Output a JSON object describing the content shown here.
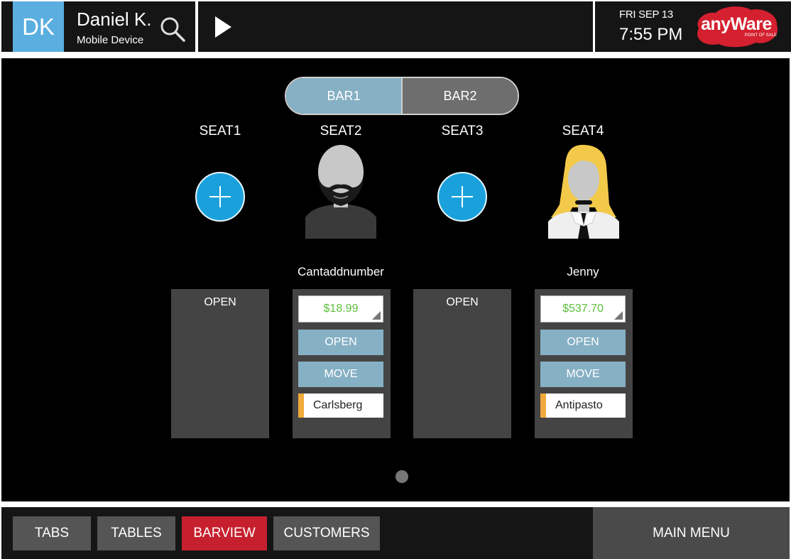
{
  "header": {
    "initials": "DK",
    "user_name": "Daniel K.",
    "device": "Mobile Device",
    "date": "FRI SEP 13",
    "time": "7:55 PM",
    "logo_text": "anyWare",
    "logo_subtext": "POINT OF SALE",
    "search_icon": "search-icon",
    "play_icon": "play-icon"
  },
  "bars": [
    {
      "label": "BAR1",
      "active": true
    },
    {
      "label": "BAR2",
      "active": false
    }
  ],
  "seats": [
    {
      "label": "SEAT1",
      "occupied": false,
      "open_label": "OPEN"
    },
    {
      "label": "SEAT2",
      "occupied": true,
      "customer": "Cantaddnumber",
      "amount": "$18.99",
      "open_label": "OPEN",
      "move_label": "MOVE",
      "item": "Carlsberg"
    },
    {
      "label": "SEAT3",
      "occupied": false,
      "open_label": "OPEN"
    },
    {
      "label": "SEAT4",
      "occupied": true,
      "customer": "Jenny",
      "amount": "$537.70",
      "open_label": "OPEN",
      "move_label": "MOVE",
      "item": "Antipasto"
    }
  ],
  "footer": {
    "tabs": [
      {
        "label": "TABS",
        "active": false
      },
      {
        "label": "TABLES",
        "active": false
      },
      {
        "label": "BARVIEW",
        "active": true
      },
      {
        "label": "CUSTOMERS",
        "active": false
      }
    ],
    "main_menu": "MAIN MENU"
  },
  "colors": {
    "accent_blue": "#86b0c4",
    "add_blue": "#1aa1dc",
    "active_red": "#c6202e",
    "amount_green": "#5cbf3b",
    "item_marker": "#f2a93b"
  }
}
